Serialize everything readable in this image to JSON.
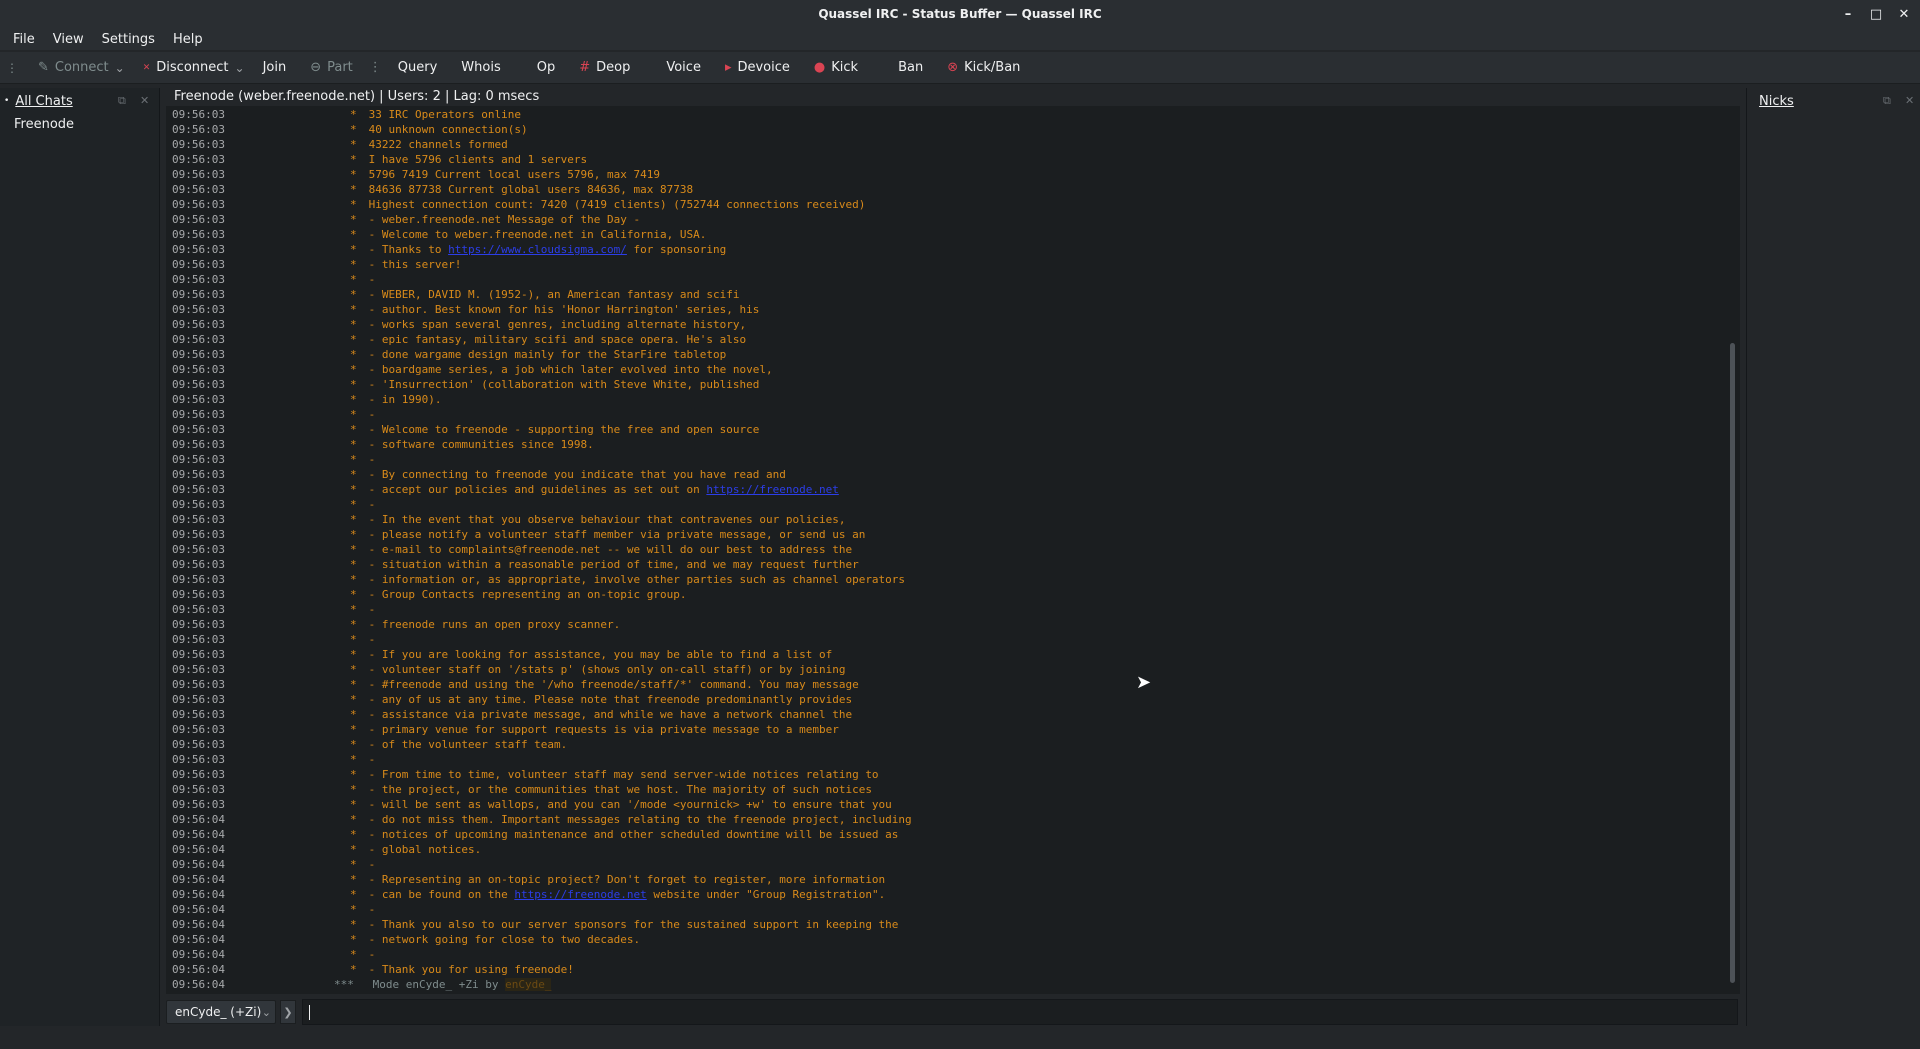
{
  "window": {
    "title": "Quassel IRC - Status Buffer — Quassel IRC"
  },
  "menu": [
    "File",
    "View",
    "Settings",
    "Help"
  ],
  "toolbar": {
    "connect": "Connect",
    "disconnect": "Disconnect",
    "join": "Join",
    "part": "Part",
    "query": "Query",
    "whois": "Whois",
    "op": "Op",
    "deop": "Deop",
    "voice": "Voice",
    "devoice": "Devoice",
    "kick": "Kick",
    "ban": "Ban",
    "kickban": "Kick/Ban"
  },
  "left_panel": {
    "title": "All Chats",
    "network": "Freenode"
  },
  "right_panel": {
    "title": "Nicks"
  },
  "topic": "Freenode (weber.freenode.net) | Users: 2 | Lag: 0 msecs",
  "input": {
    "nick": "enCyde_ (+Zi)"
  },
  "chat": [
    {
      "t": "09:56:03",
      "s": "*",
      "m": "33 IRC Operators online"
    },
    {
      "t": "09:56:03",
      "s": "*",
      "m": "40 unknown connection(s)"
    },
    {
      "t": "09:56:03",
      "s": "*",
      "m": "43222 channels formed"
    },
    {
      "t": "09:56:03",
      "s": "*",
      "m": "I have 5796 clients and 1 servers"
    },
    {
      "t": "09:56:03",
      "s": "*",
      "m": "5796 7419 Current local users 5796, max 7419"
    },
    {
      "t": "09:56:03",
      "s": "*",
      "m": "84636 87738 Current global users 84636, max 87738"
    },
    {
      "t": "09:56:03",
      "s": "*",
      "m": "Highest connection count: 7420 (7419 clients) (752744 connections received)"
    },
    {
      "t": "09:56:03",
      "s": "*",
      "m": "- weber.freenode.net Message of the Day -"
    },
    {
      "t": "09:56:03",
      "s": "*",
      "m": "- Welcome to weber.freenode.net in California, USA."
    },
    {
      "t": "09:56:03",
      "s": "*",
      "m": "- Thanks to ",
      "link": "https://www.cloudsigma.com/",
      "after": " for sponsoring"
    },
    {
      "t": "09:56:03",
      "s": "*",
      "m": "- this server!"
    },
    {
      "t": "09:56:03",
      "s": "*",
      "m": "-"
    },
    {
      "t": "09:56:03",
      "s": "*",
      "m": "- WEBER, DAVID M. (1952-), an American fantasy and scifi"
    },
    {
      "t": "09:56:03",
      "s": "*",
      "m": "- author. Best known for his 'Honor Harrington' series, his"
    },
    {
      "t": "09:56:03",
      "s": "*",
      "m": "- works span several genres, including alternate history,"
    },
    {
      "t": "09:56:03",
      "s": "*",
      "m": "- epic fantasy, military scifi and space opera. He's also"
    },
    {
      "t": "09:56:03",
      "s": "*",
      "m": "- done wargame design mainly for the StarFire tabletop"
    },
    {
      "t": "09:56:03",
      "s": "*",
      "m": "- boardgame series, a job which later evolved into the novel,"
    },
    {
      "t": "09:56:03",
      "s": "*",
      "m": "- 'Insurrection' (collaboration with Steve White, published"
    },
    {
      "t": "09:56:03",
      "s": "*",
      "m": "- in 1990)."
    },
    {
      "t": "09:56:03",
      "s": "*",
      "m": "-"
    },
    {
      "t": "09:56:03",
      "s": "*",
      "m": "- Welcome to freenode - supporting the free and open source"
    },
    {
      "t": "09:56:03",
      "s": "*",
      "m": "- software communities since 1998."
    },
    {
      "t": "09:56:03",
      "s": "*",
      "m": "-"
    },
    {
      "t": "09:56:03",
      "s": "*",
      "m": "- By connecting to freenode you indicate that you have read and"
    },
    {
      "t": "09:56:03",
      "s": "*",
      "m": "- accept our policies and guidelines as set out on ",
      "link": "https://freenode.net",
      "after": ""
    },
    {
      "t": "09:56:03",
      "s": "*",
      "m": "-"
    },
    {
      "t": "09:56:03",
      "s": "*",
      "m": "- In the event that you observe behaviour that contravenes our policies,"
    },
    {
      "t": "09:56:03",
      "s": "*",
      "m": "- please notify a volunteer staff member via private message, or send us an"
    },
    {
      "t": "09:56:03",
      "s": "*",
      "m": "- e-mail to complaints@freenode.net -- we will do our best to address the"
    },
    {
      "t": "09:56:03",
      "s": "*",
      "m": "- situation within a reasonable period of time, and we may request further"
    },
    {
      "t": "09:56:03",
      "s": "*",
      "m": "- information or, as appropriate, involve other parties such as channel operators"
    },
    {
      "t": "09:56:03",
      "s": "*",
      "m": "- Group Contacts representing an on-topic group."
    },
    {
      "t": "09:56:03",
      "s": "*",
      "m": "-"
    },
    {
      "t": "09:56:03",
      "s": "*",
      "m": "- freenode runs an open proxy scanner."
    },
    {
      "t": "09:56:03",
      "s": "*",
      "m": "-"
    },
    {
      "t": "09:56:03",
      "s": "*",
      "m": "- If you are looking for assistance, you may be able to find a list of"
    },
    {
      "t": "09:56:03",
      "s": "*",
      "m": "- volunteer staff on '/stats p' (shows only on-call staff) or by joining"
    },
    {
      "t": "09:56:03",
      "s": "*",
      "m": "- #freenode and using the '/who freenode/staff/*' command. You may message"
    },
    {
      "t": "09:56:03",
      "s": "*",
      "m": "- any of us at any time. Please note that freenode predominantly provides"
    },
    {
      "t": "09:56:03",
      "s": "*",
      "m": "- assistance via private message, and while we have a network channel the"
    },
    {
      "t": "09:56:03",
      "s": "*",
      "m": "- primary venue for support requests is via private message to a member"
    },
    {
      "t": "09:56:03",
      "s": "*",
      "m": "- of the volunteer staff team."
    },
    {
      "t": "09:56:03",
      "s": "*",
      "m": "-"
    },
    {
      "t": "09:56:03",
      "s": "*",
      "m": "- From time to time, volunteer staff may send server-wide notices relating to"
    },
    {
      "t": "09:56:03",
      "s": "*",
      "m": "- the project, or the communities that we host. The majority of such notices"
    },
    {
      "t": "09:56:03",
      "s": "*",
      "m": "- will be sent as wallops, and you can '/mode <yournick> +w' to ensure that you"
    },
    {
      "t": "09:56:04",
      "s": "*",
      "m": "- do not miss them. Important messages relating to the freenode project, including"
    },
    {
      "t": "09:56:04",
      "s": "*",
      "m": "- notices of upcoming maintenance and other scheduled downtime will be issued as"
    },
    {
      "t": "09:56:04",
      "s": "*",
      "m": "- global notices."
    },
    {
      "t": "09:56:04",
      "s": "*",
      "m": "-"
    },
    {
      "t": "09:56:04",
      "s": "*",
      "m": "- Representing an on-topic project? Don't forget to register, more information"
    },
    {
      "t": "09:56:04",
      "s": "*",
      "m": "- can be found on the ",
      "link": "https://freenode.net",
      "after": " website under \"Group Registration\"."
    },
    {
      "t": "09:56:04",
      "s": "*",
      "m": "-"
    },
    {
      "t": "09:56:04",
      "s": "*",
      "m": "- Thank you also to our server sponsors for the sustained support in keeping the"
    },
    {
      "t": "09:56:04",
      "s": "*",
      "m": "- network going for close to two decades."
    },
    {
      "t": "09:56:04",
      "s": "*",
      "m": "-"
    },
    {
      "t": "09:56:04",
      "s": "*",
      "m": "- Thank you for using freenode!"
    },
    {
      "t": "09:56:04",
      "s": "***",
      "m": "Mode enCyde_ +Zi by ",
      "nick": "enCyde_"
    }
  ]
}
